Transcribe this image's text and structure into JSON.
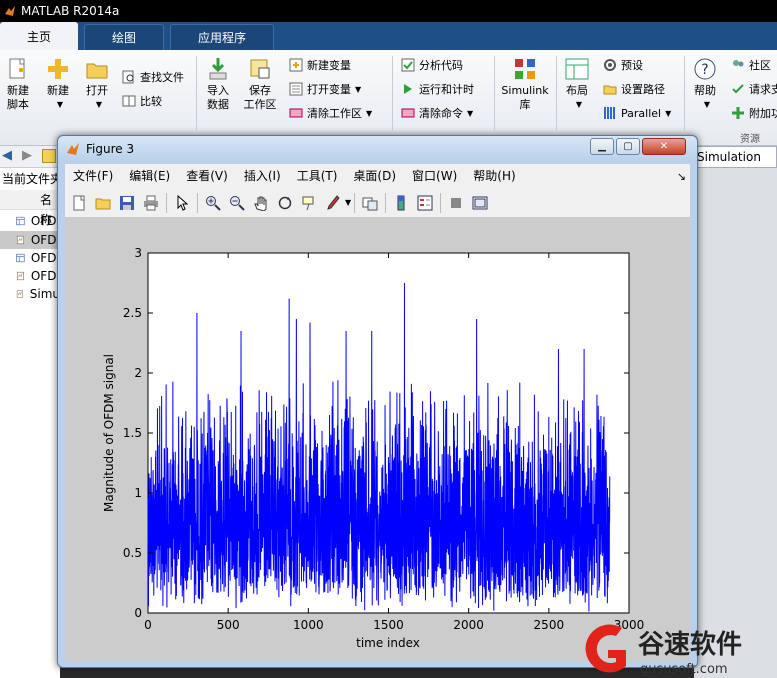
{
  "app": {
    "title": "MATLAB R2014a",
    "tabs": [
      {
        "label": "主页"
      },
      {
        "label": "绘图"
      },
      {
        "label": "应用程序"
      }
    ]
  },
  "ribbon": {
    "new_script": "新建\n脚本",
    "new": "新建",
    "open": "打开",
    "find_files": "查找文件",
    "compare": "比较",
    "import_data": "导入\n数据",
    "save_workspace": "保存\n工作区",
    "new_variable": "新建变量",
    "open_variable": "打开变量",
    "clear_workspace": "清除工作区",
    "analyze_code": "分析代码",
    "run_and_time": "运行和计时",
    "clear_commands": "清除命令",
    "simulink": "Simulink\n库",
    "layout": "布局",
    "preferences": "预设",
    "set_path": "设置路径",
    "parallel": "Parallel",
    "help": "帮助",
    "community": "社区",
    "request_support": "请求支",
    "addons": "附加功",
    "resources_group": "资源"
  },
  "filebrowser": {
    "current_folder": "当前文件夹",
    "name_col": "名称",
    "files": [
      {
        "label": "OFDI"
      },
      {
        "label": "OFDI"
      },
      {
        "label": "OFDI"
      },
      {
        "label": "OFDI"
      },
      {
        "label": "Simu"
      }
    ],
    "right_field": "Simulation"
  },
  "figure": {
    "title": "Figure 3",
    "menu": [
      "文件(F)",
      "编辑(E)",
      "查看(V)",
      "插入(I)",
      "工具(T)",
      "桌面(D)",
      "窗口(W)",
      "帮助(H)"
    ]
  },
  "chart_data": {
    "type": "line",
    "title": "",
    "xlabel": "time index",
    "ylabel": "Magnitude of OFDM signal",
    "xlim": [
      0,
      3000
    ],
    "ylim": [
      0,
      3
    ],
    "xticks": [
      0,
      500,
      1000,
      1500,
      2000,
      2500,
      3000
    ],
    "yticks": [
      0,
      0.5,
      1,
      1.5,
      2,
      2.5,
      3
    ],
    "series": [
      {
        "n_points": 2880,
        "x_range": [
          0,
          2880
        ],
        "typical_band": [
          0.3,
          1.6
        ],
        "mean": 0.88,
        "peaks": [
          {
            "x": 305,
            "y": 2.5
          },
          {
            "x": 580,
            "y": 2.35
          },
          {
            "x": 880,
            "y": 2.62
          },
          {
            "x": 925,
            "y": 2.45
          },
          {
            "x": 1010,
            "y": 2.42
          },
          {
            "x": 1235,
            "y": 2.35
          },
          {
            "x": 1395,
            "y": 2.35
          },
          {
            "x": 1600,
            "y": 2.75
          },
          {
            "x": 2050,
            "y": 2.45
          },
          {
            "x": 2560,
            "y": 2.2
          },
          {
            "x": 2720,
            "y": 2.2
          }
        ],
        "color": "#0000ff"
      }
    ],
    "grid": false,
    "legend": "none"
  },
  "watermark": {
    "brand": "谷速软件",
    "url": "gususoft.com"
  }
}
